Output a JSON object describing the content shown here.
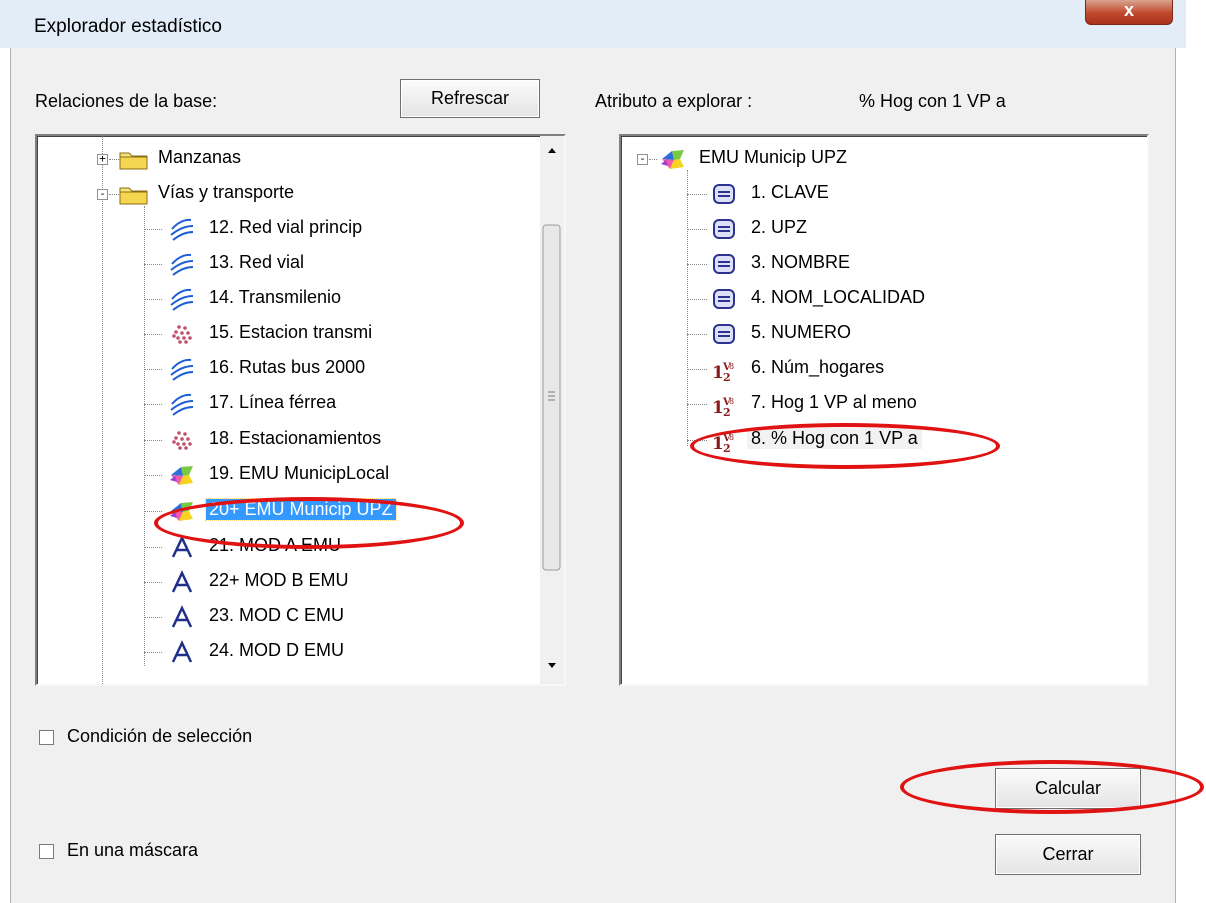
{
  "window": {
    "title": "Explorador estadístico",
    "close_label": "x"
  },
  "left_panel": {
    "label": "Relaciones de la base:",
    "refresh_label": "Refrescar",
    "items": [
      {
        "label": "Manzanas",
        "icon": "folder-icon"
      },
      {
        "label": "Vías y transporte",
        "icon": "folder-icon"
      },
      {
        "label": "12. Red vial princip",
        "icon": "line-layer-icon"
      },
      {
        "label": "13. Red vial",
        "icon": "line-layer-icon"
      },
      {
        "label": "14. Transmilenio",
        "icon": "line-layer-icon"
      },
      {
        "label": "15. Estacion transmi",
        "icon": "point-layer-icon"
      },
      {
        "label": "16. Rutas bus 2000",
        "icon": "line-layer-icon"
      },
      {
        "label": "17. Línea férrea",
        "icon": "line-layer-icon"
      },
      {
        "label": "18. Estacionamientos",
        "icon": "point-layer-icon"
      },
      {
        "label": "19. EMU MunicipLocal",
        "icon": "polygon-layer-icon"
      },
      {
        "label": "20+ EMU Municip UPZ",
        "icon": "polygon-layer-icon",
        "selected": true
      },
      {
        "label": "21. MOD A EMU",
        "icon": "text-layer-icon"
      },
      {
        "label": "22+ MOD B EMU",
        "icon": "text-layer-icon"
      },
      {
        "label": "23. MOD C EMU",
        "icon": "text-layer-icon"
      },
      {
        "label": "24. MOD D EMU",
        "icon": "text-layer-icon"
      }
    ]
  },
  "right_panel": {
    "label": "Atributo a explorar :",
    "value": "% Hog con 1 VP a",
    "root": {
      "label": "EMU Municip UPZ",
      "icon": "polygon-layer-icon"
    },
    "items": [
      {
        "label": "1. CLAVE",
        "icon": "text-field-icon"
      },
      {
        "label": "2. UPZ",
        "icon": "text-field-icon"
      },
      {
        "label": "3. NOMBRE",
        "icon": "text-field-icon"
      },
      {
        "label": "4. NOM_LOCALIDAD",
        "icon": "text-field-icon"
      },
      {
        "label": "5. NUMERO",
        "icon": "text-field-icon"
      },
      {
        "label": "6. Núm_hogares",
        "icon": "numeric-field-icon"
      },
      {
        "label": "7. Hog 1 VP al meno",
        "icon": "numeric-field-icon"
      },
      {
        "label": "8. % Hog con 1 VP a",
        "icon": "numeric-field-icon",
        "selected": true
      }
    ]
  },
  "options": {
    "condition_label": "Condición de selección",
    "mask_label": "En una máscara"
  },
  "buttons": {
    "calcular": "Calcular",
    "cerrar": "Cerrar"
  },
  "colors": {
    "selection": "#3399ff",
    "annotation": "#e01212"
  }
}
